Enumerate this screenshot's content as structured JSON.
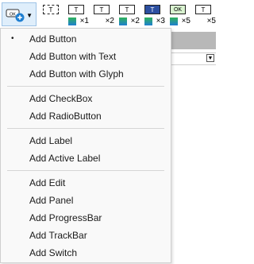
{
  "toolbar": {
    "buttons": [
      {
        "icon": "button-icon",
        "box": "T",
        "mult": ""
      },
      {
        "icon": "button-x1-icon",
        "box": "T",
        "mult": "×1"
      },
      {
        "icon": "button-x2-icon",
        "box": "T",
        "mult": "×2"
      },
      {
        "icon": "button-glyph-x2-icon",
        "box": "T",
        "mult": "×2"
      },
      {
        "icon": "button-x3-icon",
        "box": "T",
        "mult": "×3"
      },
      {
        "icon": "checkbox-x5-icon",
        "box": "OK",
        "mult": "×5"
      },
      {
        "icon": "button-x5-icon",
        "box": "T",
        "mult": "×5"
      }
    ]
  },
  "menu": {
    "items": [
      {
        "label": "Add Button",
        "checked": true
      },
      {
        "label": "Add Button with Text",
        "checked": false
      },
      {
        "label": "Add Button with Glyph",
        "checked": false
      },
      {
        "label": "Add CheckBox",
        "checked": false
      },
      {
        "label": "Add RadioButton",
        "checked": false
      },
      {
        "label": "Add Label",
        "checked": false
      },
      {
        "label": "Add Active Label",
        "checked": false
      },
      {
        "label": "Add Edit",
        "checked": false
      },
      {
        "label": "Add Panel",
        "checked": false
      },
      {
        "label": "Add ProgressBar",
        "checked": false
      },
      {
        "label": "Add TrackBar",
        "checked": false
      },
      {
        "label": "Add Switch",
        "checked": false
      }
    ],
    "bullet": "•"
  },
  "colors": {
    "accent": "#1f7fd1",
    "menu_bg": "#f9f9f9",
    "separator": "#d6d6d6"
  }
}
